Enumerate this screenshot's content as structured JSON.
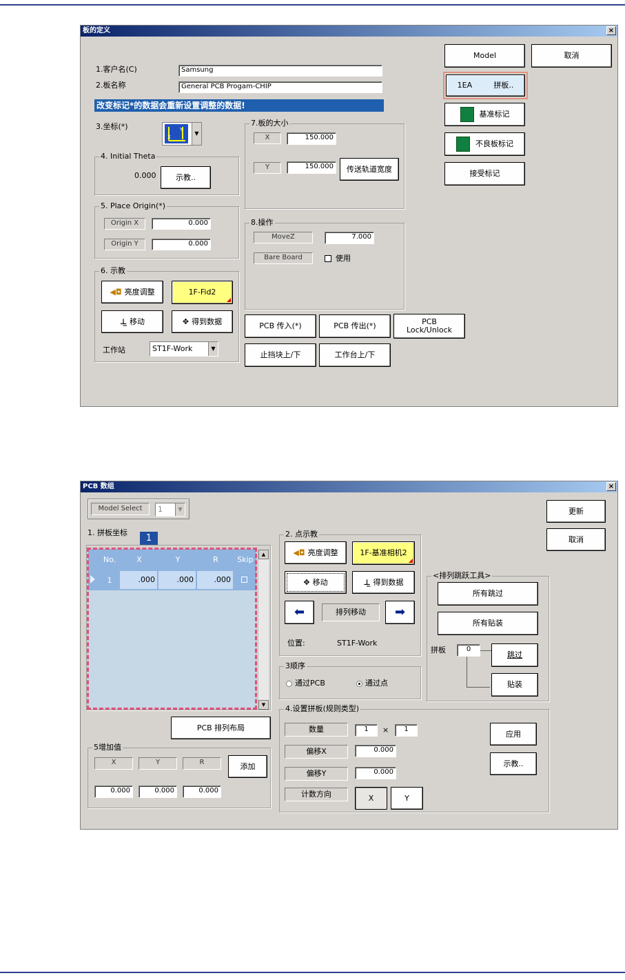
{
  "colors": {
    "title_gradient_start": "#0a246a",
    "title_gradient_end": "#a6caf0",
    "banner": "#1f5fad",
    "highlight_yellow": "#ffff80",
    "grid_blue": "#8fb4e0",
    "selection_pink": "#e0507a"
  },
  "dialog1": {
    "title": "板的定义",
    "close": "×",
    "customer_label": "1.客户名(C)",
    "customer_value": "Samsung",
    "board_label": "2.板名称",
    "board_value": "General PCB Progam-CHIP",
    "banner": "改变标记*的数据会重新设置调整的数据!",
    "coord_label": "3.坐标(*)",
    "coord_icon": "axis-icon",
    "theta_group": "4. Initial Theta",
    "theta_value": "0.000",
    "teach_button": "示教..",
    "origin_group": "5. Place Origin(*)",
    "origin_x_label": "Origin X",
    "origin_x_value": "0.000",
    "origin_y_label": "Origin Y",
    "origin_y_value": "0.000",
    "teach_group": "6. 示教",
    "brightness_button": "亮度调整",
    "fid_button": "1F-Fid2",
    "move_button": "移动",
    "getdata_button": "得到数据",
    "station_label": "工作站",
    "station_value": "ST1F-Work",
    "size_group": "7.板的大小",
    "size_x_label": "X",
    "size_x_value": "150.000",
    "size_y_label": "Y",
    "size_y_value": "150.000",
    "rail_button": "传送轨道宽度",
    "op_group": "8.操作",
    "movez_label": "MoveZ",
    "movez_value": "7.000",
    "bareboard_label": "Bare Board",
    "use_label": "使用",
    "pcb_in": "PCB 传入(*)",
    "pcb_out": "PCB 传出(*)",
    "pcb_lock": "PCB\nLock/Unlock",
    "stopper": "止挡块上/下",
    "table_updown": "工作台上/下",
    "model_button": "Model",
    "cancel_button": "取消",
    "array_button_left": "1EA",
    "array_button_right": "拼板..",
    "fiducial_button": "基准标记",
    "badmark_button": "不良板标记",
    "accept_button": "接受标记"
  },
  "dialog2": {
    "title": "PCB 数组",
    "close": "×",
    "model_select_label": "Model Select",
    "model_select_value": "1",
    "coords_group": "1. 拼板坐标",
    "badge": "1",
    "columns": [
      "No.",
      "X",
      "Y",
      "R",
      "Skip"
    ],
    "row": {
      "no": "1",
      "x": ".000",
      "y": ".000",
      "r": ".000"
    },
    "point_group": "2. 点示教",
    "brightness_button": "亮度调整",
    "fid_button": "1F-基准相机2",
    "move_button": "移动",
    "getdata_button": "得到数据",
    "array_move": "排列移动",
    "position_label": "位置:",
    "position_value": "ST1F-Work",
    "order_group": "3顺序",
    "order_pcb": "通过PCB",
    "order_point": "通过点",
    "layout_button": "PCB 排列布局",
    "setup_group": "4.设置拼板(规则类型)",
    "count_label": "数量",
    "count_a": "1",
    "count_times": "×",
    "count_b": "1",
    "offset_x_label": "偏移X",
    "offset_x_value": "0.000",
    "offset_y_label": "偏移Y",
    "offset_y_value": "0.000",
    "direction_label": "计数方向",
    "dir_x": "X",
    "dir_y": "Y",
    "apply_button": "应用",
    "teach_button": "示教..",
    "increment_group": "5增加值",
    "inc_x_label": "X",
    "inc_y_label": "Y",
    "inc_r_label": "R",
    "add_button": "添加",
    "inc_x_value": "0.000",
    "inc_y_value": "0.000",
    "inc_r_value": "0.000",
    "update_button": "更新",
    "cancel_button": "取消",
    "skip_tool_group": "<排列跳跃工具>",
    "skip_all": "所有跳过",
    "place_all": "所有贴装",
    "panel_label": "拼板",
    "panel_value": "0",
    "skip_button": "跳过",
    "place_button": "贴装"
  }
}
